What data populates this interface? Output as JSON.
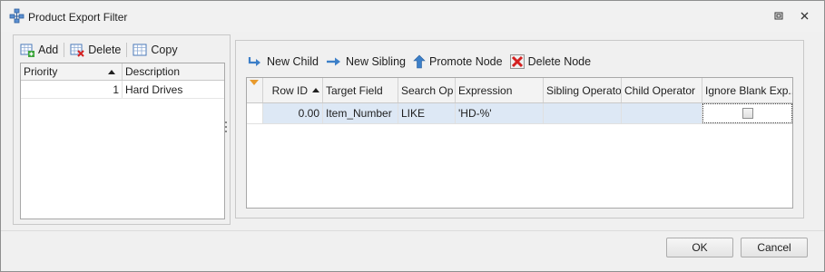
{
  "window": {
    "title": "Product Export Filter",
    "icons": {
      "app": "filter-network-icon",
      "restore": "restore-icon",
      "close": "close-icon"
    }
  },
  "left_toolbar": {
    "add_label": "Add",
    "delete_label": "Delete",
    "copy_label": "Copy",
    "icons": {
      "add": "add-grid-icon",
      "delete": "delete-grid-icon",
      "copy": "copy-grid-icon"
    }
  },
  "left_grid": {
    "columns": [
      "Priority",
      "Description"
    ],
    "sorted_column": "Priority",
    "rows": [
      {
        "priority": "1",
        "description": "Hard Drives"
      }
    ]
  },
  "right_toolbar": {
    "new_child_label": "New Child",
    "new_sibling_label": "New Sibling",
    "promote_node_label": "Promote Node",
    "delete_node_label": "Delete Node",
    "icons": {
      "new_child": "new-child-arrow-icon",
      "new_sibling": "new-sibling-arrow-icon",
      "promote_node": "up-arrow-icon",
      "delete_node": "red-x-icon"
    }
  },
  "right_grid": {
    "columns": [
      "Row ID",
      "Target Field",
      "Search Op",
      "Expression",
      "Sibling Operator",
      "Child Operator",
      "Ignore Blank Exp..."
    ],
    "sorted_column": "Row ID",
    "rows": [
      {
        "row_id": "0.00",
        "target_field": "Item_Number",
        "search_op": "LIKE",
        "expression": "'HD-%'",
        "sibling_operator": "",
        "child_operator": "",
        "ignore_blank": false
      }
    ]
  },
  "footer": {
    "ok_label": "OK",
    "cancel_label": "Cancel"
  },
  "colors": {
    "selected_row": "#dde8f5",
    "accent_blue": "#3c7fc8",
    "delete_red": "#d42020"
  }
}
